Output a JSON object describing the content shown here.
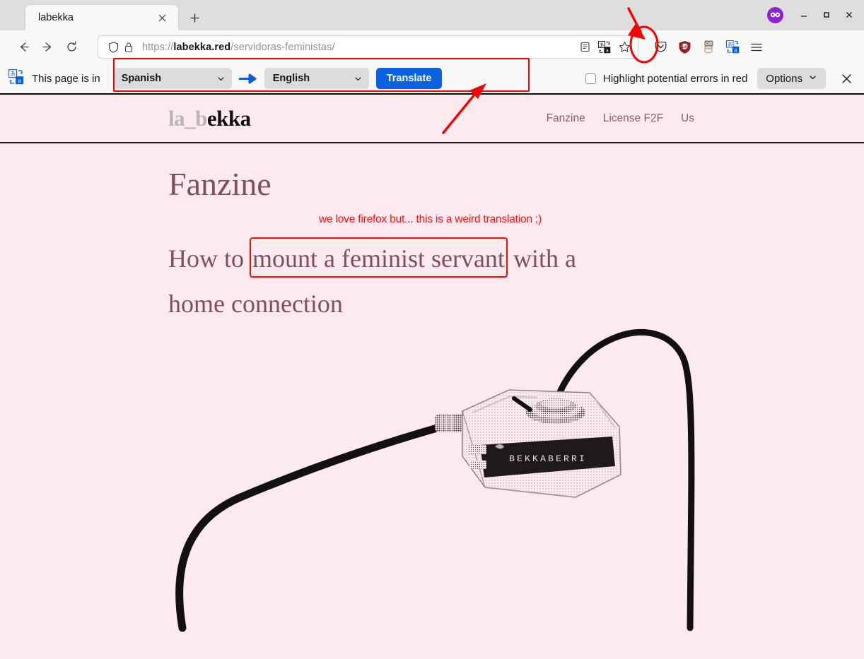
{
  "window": {
    "tab_title": "labekka",
    "new_tab_label": "+",
    "close_tab_label": "×",
    "minimize_label": "–",
    "maximize_label": "□",
    "close_label": "×"
  },
  "nav": {
    "back_label": "←",
    "forward_label": "→",
    "reload_label": "↻"
  },
  "urlbar": {
    "scheme": "https://",
    "host": "labekka.red",
    "path": "/servidoras-feministas/",
    "full_url": "https://labekka.red/servidoras-feministas/"
  },
  "toolbar": {
    "icons": [
      "pocket-icon",
      "ublock-origin-icon",
      "cookie-off-icon",
      "firefox-translations-icon",
      "hamburger-menu-icon"
    ],
    "cookie_badge": "Off"
  },
  "translation_bar": {
    "lead_text": "This page is in",
    "source_language": "Spanish",
    "target_language": "English",
    "translate_button": "Translate",
    "highlight_checkbox_label": "Highlight potential errors in red",
    "highlight_checked": false,
    "options_button": "Options",
    "close_label": "✕",
    "accent_color": "#0a62e0",
    "arrow_color": "#0a5fd4"
  },
  "site": {
    "logo_dim": "la_b",
    "logo_bold": "ekka",
    "nav_links": [
      {
        "label": "Fanzine"
      },
      {
        "label": "License F2F"
      },
      {
        "label": "Us"
      }
    ],
    "page_title": "Fanzine",
    "annotation_note": "we love firefox but... this is a weird translation ;)",
    "heading_part1": "How to ",
    "heading_highlight": "mount a feminist servant",
    "heading_part2": " with a home connection",
    "background_color": "#fdeaef",
    "heading_color": "#7e4f5e",
    "annotation_color": "#ff1010",
    "hero_image_label": "BEKKABERRI"
  },
  "annotations": {
    "arrow_to_translate_icon": "red-arrow-icon",
    "ellipse_around_translate_icon": "red-ellipse-icon",
    "arrow_to_translate_button": "red-arrow-icon",
    "box_around_language_controls": "red-rectangle",
    "box_around_heading_phrase": "red-rectangle",
    "color": "#f70000"
  }
}
